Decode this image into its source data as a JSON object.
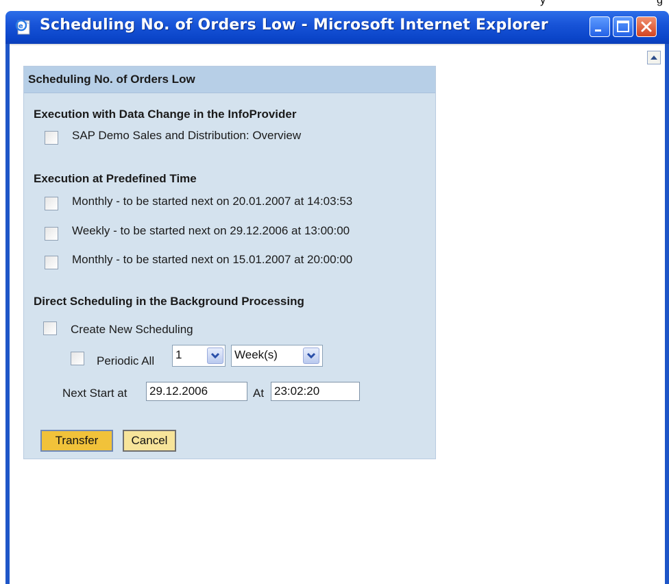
{
  "window": {
    "title": "Scheduling No. of Orders Low - Microsoft Internet Explorer",
    "background_text": "y",
    "background_text_2": "g",
    "colors": {
      "titlebar": "#1854d8",
      "close": "#d24422"
    },
    "icons": {
      "app": "ie-page-icon",
      "minimize": "minimize-icon",
      "maximize": "maximize-icon",
      "close": "close-icon",
      "scroll": "scroll-up-icon"
    }
  },
  "panel": {
    "title": "Scheduling No. of Orders Low",
    "sections": {
      "data_change": {
        "heading": "Execution with Data Change in the InfoProvider",
        "items": [
          {
            "label": "SAP Demo Sales and Distribution: Overview",
            "checked": false
          }
        ]
      },
      "predefined": {
        "heading": "Execution at Predefined Time",
        "items": [
          {
            "label": "Monthly - to be started next on 20.01.2007 at 14:03:53",
            "checked": false
          },
          {
            "label": "Weekly - to be started next on 29.12.2006 at 13:00:00",
            "checked": false
          },
          {
            "label": "Monthly - to be started next on 15.01.2007 at 20:00:00",
            "checked": false
          }
        ]
      },
      "direct": {
        "heading": "Direct Scheduling in the Background Processing",
        "create_label": "Create New Scheduling",
        "periodic_label": "Periodic All",
        "periodic_count": "1",
        "periodic_unit": "Week(s)",
        "next_start_label": "Next Start at",
        "next_start_date": "29.12.2006",
        "at_label": "At",
        "next_start_time": "23:02:20"
      }
    },
    "buttons": {
      "transfer": "Transfer",
      "cancel": "Cancel"
    },
    "colors": {
      "panel_bg": "#d4e2ee",
      "header_bg": "#b7cfe7",
      "transfer_bg": "#f1c23a",
      "cancel_bg": "#f7e49a"
    }
  }
}
